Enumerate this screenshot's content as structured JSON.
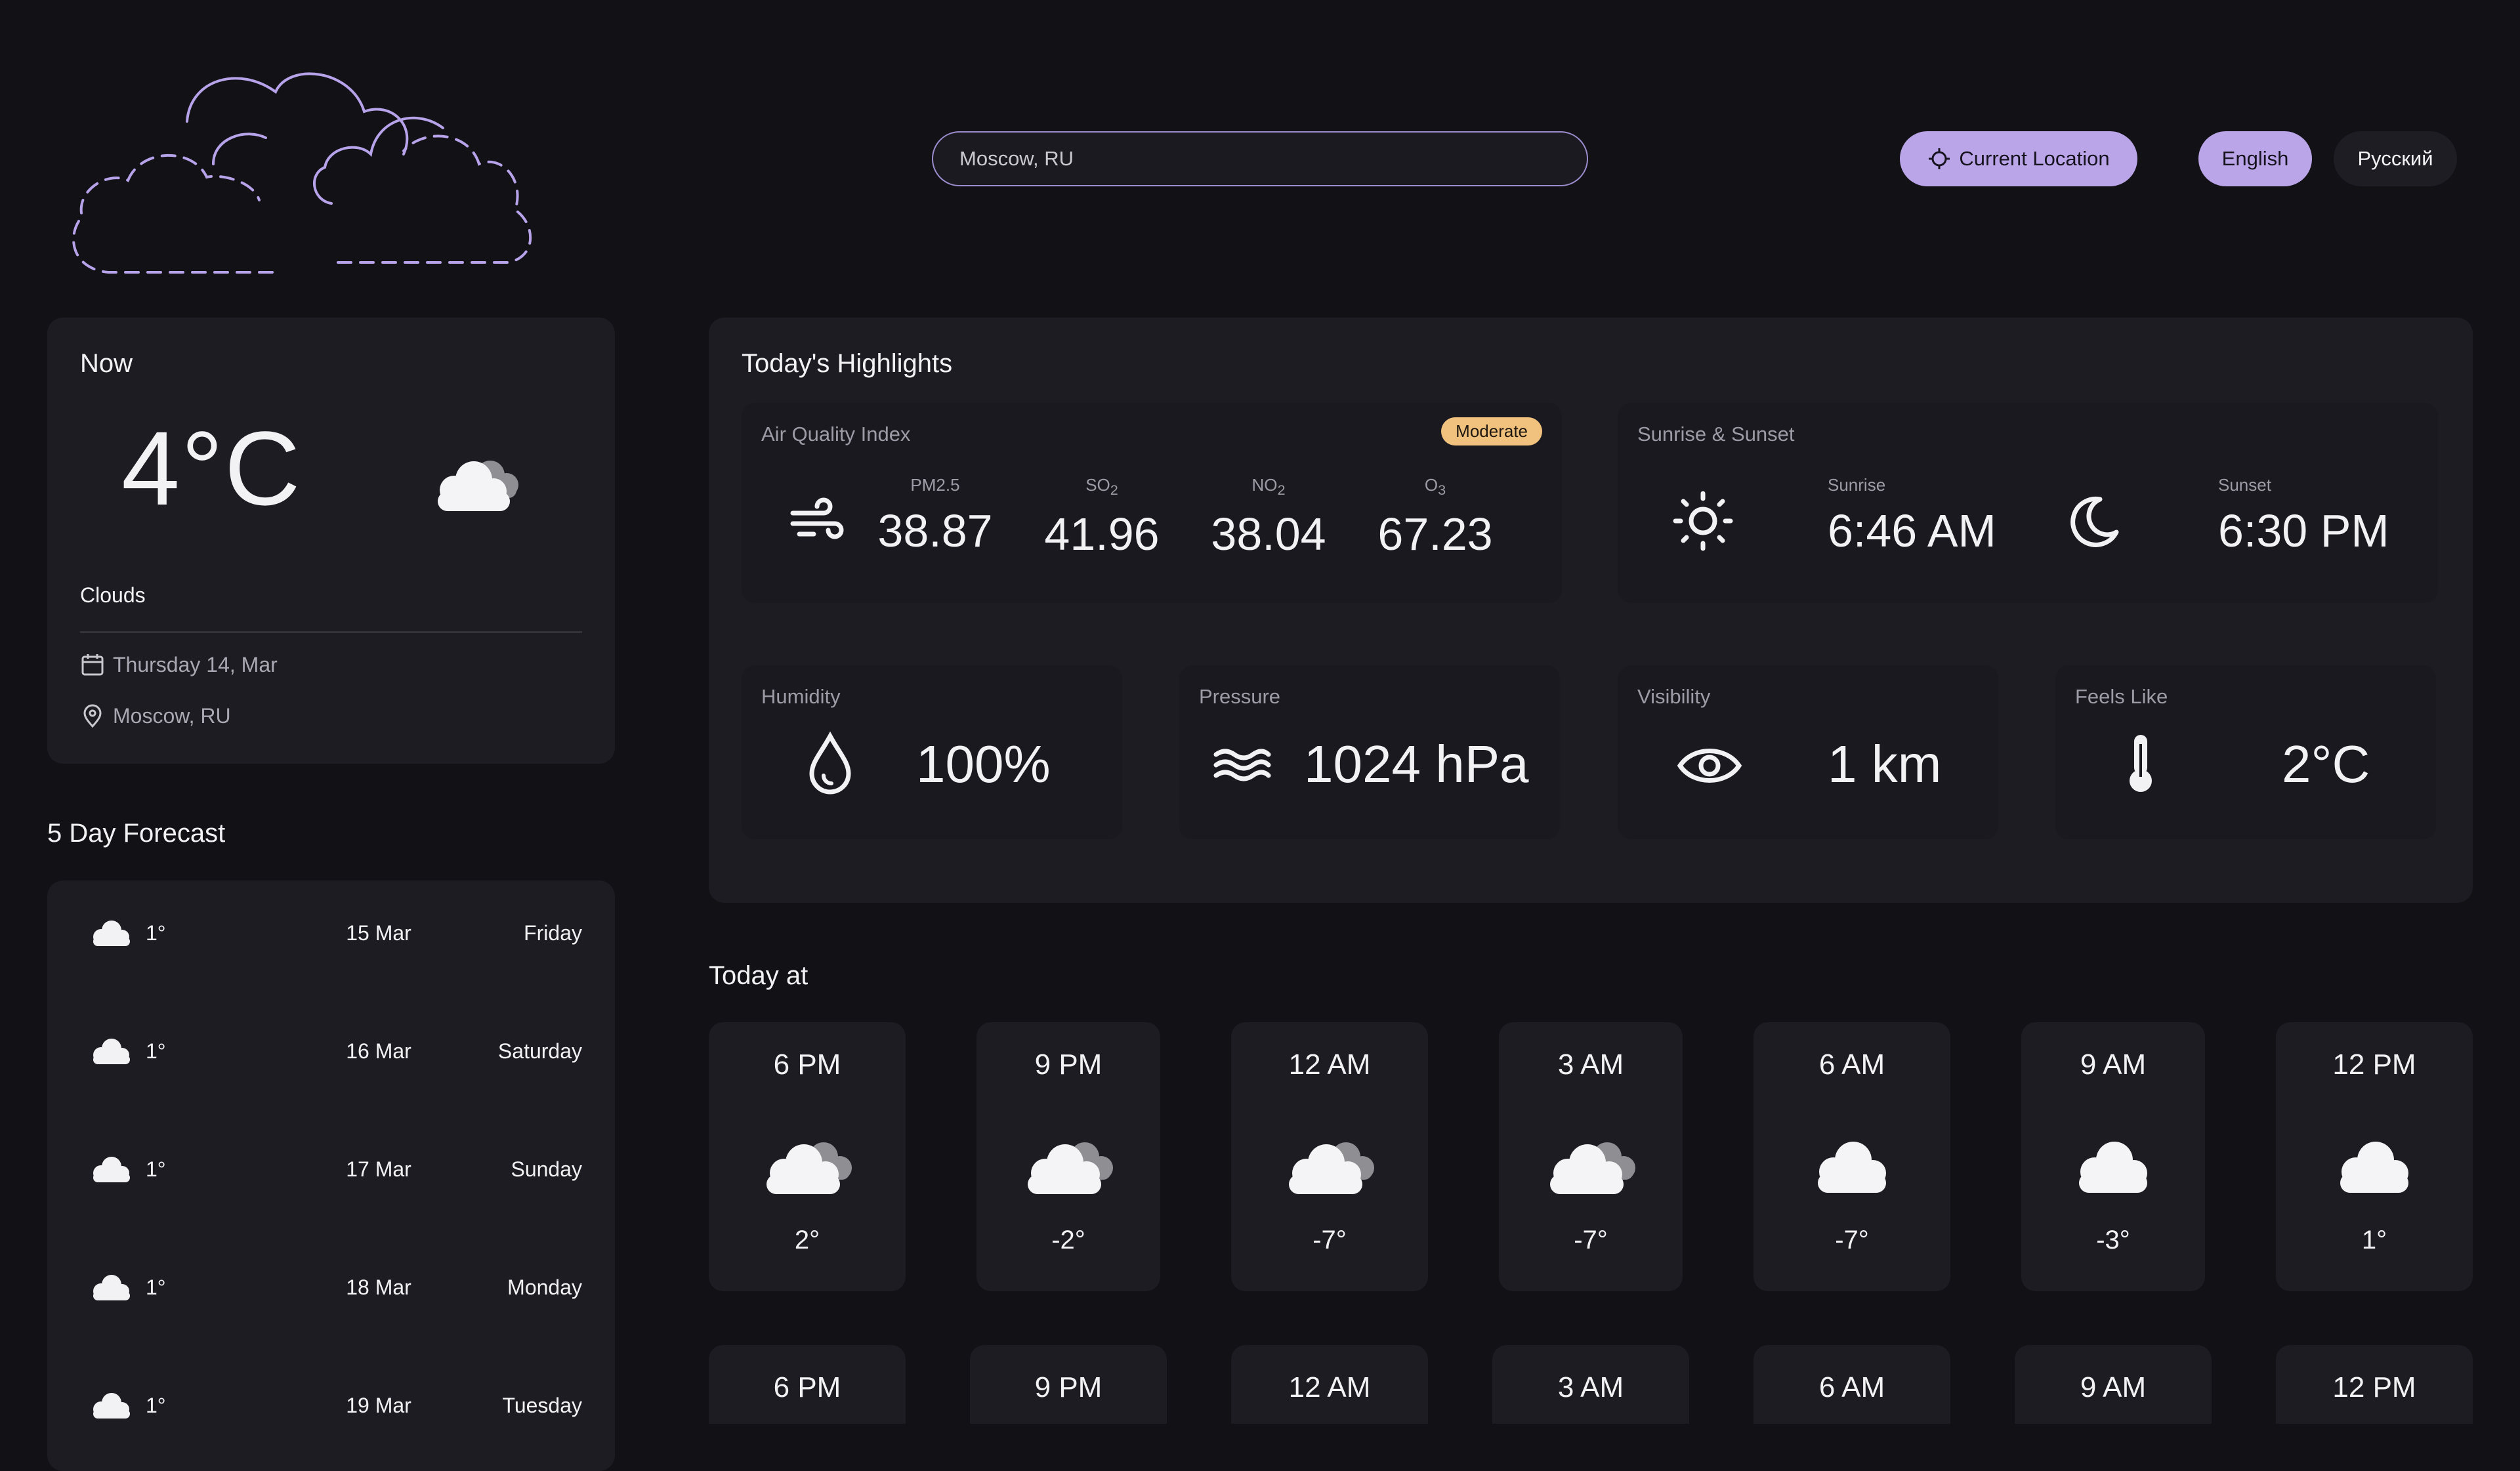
{
  "search": {
    "value": "Moscow, RU",
    "placeholder": "Moscow, RU"
  },
  "header": {
    "current_location": "Current Location",
    "lang_en": "English",
    "lang_ru": "Русский"
  },
  "now": {
    "label": "Now",
    "temp": "4°C",
    "desc": "Clouds",
    "date": "Thursday 14, Mar",
    "location": "Moscow, RU"
  },
  "forecast": {
    "title": "5 Day Forecast",
    "items": [
      {
        "temp": "1°",
        "date": "15 Mar",
        "day": "Friday",
        "icon": "cloud-icon"
      },
      {
        "temp": "1°",
        "date": "16 Mar",
        "day": "Saturday",
        "icon": "cloud-icon"
      },
      {
        "temp": "1°",
        "date": "17 Mar",
        "day": "Sunday",
        "icon": "cloud-icon"
      },
      {
        "temp": "1°",
        "date": "18 Mar",
        "day": "Monday",
        "icon": "cloud-icon"
      },
      {
        "temp": "1°",
        "date": "19 Mar",
        "day": "Tuesday",
        "icon": "cloud-icon"
      }
    ]
  },
  "highlights": {
    "title": "Today's Highlights",
    "aqi": {
      "label": "Air Quality Index",
      "badge": "Moderate",
      "items": [
        {
          "key": "PM2.5",
          "sub": "",
          "value": "38.87"
        },
        {
          "key": "SO",
          "sub": "2",
          "value": "41.96"
        },
        {
          "key": "NO",
          "sub": "2",
          "value": "38.04"
        },
        {
          "key": "O",
          "sub": "3",
          "value": "67.23"
        }
      ]
    },
    "sun": {
      "label": "Sunrise & Sunset",
      "sunrise_label": "Sunrise",
      "sunrise": "6:46 AM",
      "sunset_label": "Sunset",
      "sunset": "6:30 PM"
    },
    "humidity": {
      "label": "Humidity",
      "value": "100%"
    },
    "pressure": {
      "label": "Pressure",
      "value": "1024 hPa"
    },
    "visibility": {
      "label": "Visibility",
      "value": "1 km"
    },
    "feels_like": {
      "label": "Feels Like",
      "value": "2°C"
    }
  },
  "today": {
    "title": "Today at",
    "hours": [
      {
        "time": "6 PM",
        "temp": "2°",
        "icon": "broken-clouds-icon"
      },
      {
        "time": "9 PM",
        "temp": "-2°",
        "icon": "broken-clouds-icon"
      },
      {
        "time": "12 AM",
        "temp": "-7°",
        "icon": "broken-clouds-icon"
      },
      {
        "time": "3 AM",
        "temp": "-7°",
        "icon": "broken-clouds-icon"
      },
      {
        "time": "6 AM",
        "temp": "-7°",
        "icon": "cloud-icon"
      },
      {
        "time": "9 AM",
        "temp": "-3°",
        "icon": "cloud-icon"
      },
      {
        "time": "12 PM",
        "temp": "1°",
        "icon": "cloud-icon"
      }
    ],
    "wind_times": [
      "6 PM",
      "9 PM",
      "12 AM",
      "3 AM",
      "6 AM",
      "9 AM",
      "12 PM"
    ]
  },
  "colors": {
    "background": "#121116",
    "card": "#1d1c22",
    "accent": "#b9a5e8",
    "badge": "#f1c27d"
  }
}
